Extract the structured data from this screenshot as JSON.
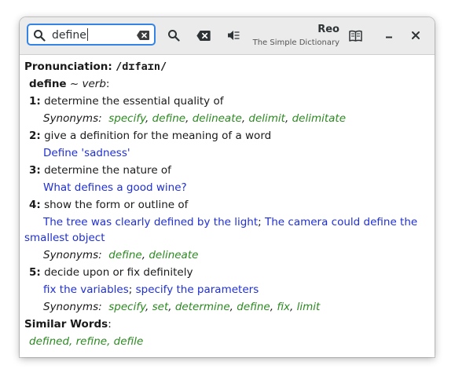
{
  "header": {
    "search_value": "define",
    "title": "Reo",
    "subtitle": "The Simple Dictionary"
  },
  "entry": {
    "pronunciation_label": "Pronunciation:",
    "pronunciation": "/dɪfaɪn/",
    "headword": "define",
    "tilde": "~",
    "pos": "verb",
    "pos_colon": ":",
    "synonyms_label": "Synonyms:",
    "senses": [
      {
        "num": "1:",
        "definition": "determine the essential quality of",
        "synonyms": [
          "specify",
          "define",
          "delineate",
          "delimit",
          "delimitate"
        ]
      },
      {
        "num": "2:",
        "definition": "give a definition for the meaning of a word",
        "examples": [
          "Define 'sadness'"
        ]
      },
      {
        "num": "3:",
        "definition": "determine the nature of",
        "examples": [
          "What defines a good wine?"
        ]
      },
      {
        "num": "4:",
        "definition": "show the form or outline of",
        "examples": [
          "The tree was clearly defined by the light",
          "The camera could define the",
          "smallest object"
        ],
        "synonyms": [
          "define",
          "delineate"
        ]
      },
      {
        "num": "5:",
        "definition": "decide upon or fix definitely",
        "examples": [
          "fix the variables",
          "specify the parameters"
        ],
        "synonyms": [
          "specify",
          "set",
          "determine",
          "define",
          "fix",
          "limit"
        ]
      }
    ],
    "separator": ";",
    "comma": ",",
    "similar_label": "Similar Words",
    "similar_colon": ":",
    "similar_words": [
      "defined",
      "refine",
      "defile"
    ]
  }
}
